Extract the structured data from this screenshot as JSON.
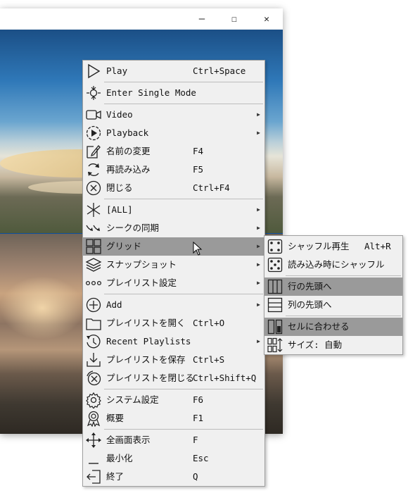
{
  "window": {
    "controls": {
      "minimize": "–",
      "maximize": "☐",
      "close": "✕"
    }
  },
  "context_menu": {
    "items": [
      {
        "label": "Play",
        "shortcut": "Ctrl+Space",
        "icon": "play-icon"
      },
      {
        "label": "Enter Single Mode",
        "shortcut": "",
        "icon": "single-mode-icon"
      },
      {
        "label": "Video",
        "shortcut": "",
        "icon": "video-icon",
        "submenu": true
      },
      {
        "label": "Playback",
        "shortcut": "",
        "icon": "playback-icon",
        "submenu": true
      },
      {
        "label": "名前の変更",
        "shortcut": "F4",
        "icon": "rename-icon"
      },
      {
        "label": "再読み込み",
        "shortcut": "F5",
        "icon": "reload-icon"
      },
      {
        "label": "閉じる",
        "shortcut": "Ctrl+F4",
        "icon": "close-circle-icon"
      },
      {
        "label": "[ALL]",
        "shortcut": "",
        "icon": "all-asterisk-icon",
        "submenu": true
      },
      {
        "label": "シークの同期",
        "shortcut": "",
        "icon": "seek-sync-icon",
        "submenu": true
      },
      {
        "label": "グリッド",
        "shortcut": "",
        "icon": "grid-icon",
        "submenu": true
      },
      {
        "label": "スナップショット",
        "shortcut": "",
        "icon": "snapshot-icon",
        "submenu": true
      },
      {
        "label": "プレイリスト設定",
        "shortcut": "",
        "icon": "playlist-settings-icon",
        "submenu": true
      },
      {
        "label": "Add",
        "shortcut": "",
        "icon": "add-icon",
        "submenu": true
      },
      {
        "label": "プレイリストを開く",
        "shortcut": "Ctrl+O",
        "icon": "folder-icon"
      },
      {
        "label": "Recent Playlists",
        "shortcut": "",
        "icon": "history-icon",
        "submenu": true
      },
      {
        "label": "プレイリストを保存",
        "shortcut": "Ctrl+S",
        "icon": "save-icon"
      },
      {
        "label": "プレイリストを閉じる",
        "shortcut": "Ctrl+Shift+Q",
        "icon": "close-playlist-icon"
      },
      {
        "label": "システム設定",
        "shortcut": "F6",
        "icon": "gear-icon"
      },
      {
        "label": "概要",
        "shortcut": "F1",
        "icon": "about-badge-icon"
      },
      {
        "label": "全画面表示",
        "shortcut": "F",
        "icon": "fullscreen-icon"
      },
      {
        "label": "最小化",
        "shortcut": "Esc",
        "icon": "minimize-icon"
      },
      {
        "label": "終了",
        "shortcut": "Q",
        "icon": "exit-icon"
      }
    ],
    "highlighted": "グリッド"
  },
  "grid_submenu": {
    "items": [
      {
        "label": "シャッフル再生",
        "shortcut": "Alt+R",
        "icon": "dice-icon"
      },
      {
        "label": "読み込み時にシャッフル",
        "shortcut": "",
        "icon": "dice-icon"
      },
      {
        "label": "行の先頭へ",
        "shortcut": "",
        "icon": "row-head-icon",
        "checked": true
      },
      {
        "label": "列の先頭へ",
        "shortcut": "",
        "icon": "column-head-icon"
      },
      {
        "label": "セルに合わせる",
        "shortcut": "",
        "icon": "fit-cell-icon",
        "checked": true
      },
      {
        "label": "サイズ: 自動",
        "shortcut": "",
        "icon": "size-auto-icon"
      }
    ]
  },
  "colors": {
    "menu_bg": "#f0f0f0",
    "highlight": "#9a9a9a",
    "window_accent": "#1e6fc8"
  }
}
